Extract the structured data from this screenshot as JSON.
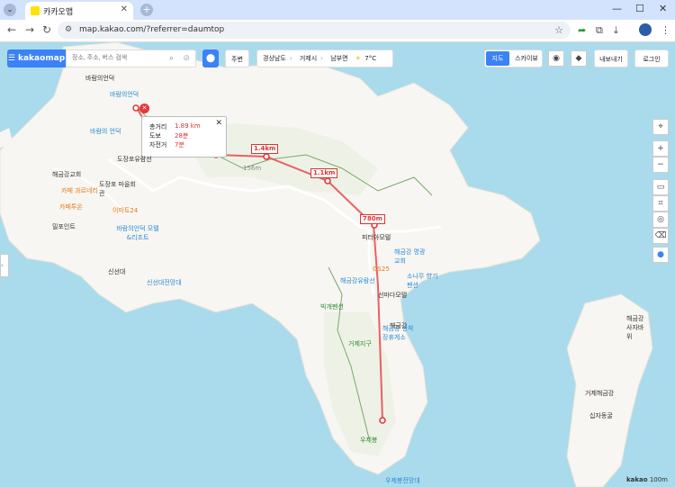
{
  "browser": {
    "tab_title": "카카오맵",
    "url": "map.kakao.com/?referrer=daumtop",
    "new_tab": "+",
    "tab_close": "✕"
  },
  "map_ui": {
    "logo": "kakaomap",
    "search_placeholder": "장소, 주소, 버스 검색",
    "nearby": "주변",
    "breadcrumb": [
      "경상남도",
      "거제시",
      "남부면"
    ],
    "weather": "7°C",
    "mode_map": "지도",
    "mode_sky": "스카이뷰",
    "export": "내보내기",
    "login": "로그인",
    "zoom_in": "+",
    "zoom_out": "−"
  },
  "route_popup": {
    "total_label": "총거리",
    "total_value": "1.89 km",
    "walk_label": "도보",
    "walk_value": "28분",
    "bike_label": "자전거",
    "bike_value": "7분"
  },
  "distance_markers": [
    "1.4km",
    "1.1km",
    "780m"
  ],
  "place_labels": {
    "p1": "바람의언덕",
    "p2": "바람의언덕",
    "p3": "바람의 언덕",
    "p4": "도장포유람선",
    "p5": "해금강교회",
    "p6": "도장포 마을회관",
    "p7": "카페 과르네리",
    "p8": "이마트24",
    "p9": "카페투온",
    "p10": "바람의언덕 모텔&리조트",
    "p11": "밀포인트",
    "p12": "신선대",
    "p13": "신선대전망대",
    "p14": "피터아모텔",
    "p15": "해금강 명광교회",
    "p16": "GS25",
    "p17": "소나무 향기펜션",
    "p18": "해금강유람선",
    "p19": "선마다모텔",
    "p20": "해금강 선착장휴게소",
    "p21": "해금강",
    "p22": "거제지구",
    "p23": "빅개펜션",
    "p24": "우제봉",
    "p25": "우제봉전망대",
    "p26": "해금강 사자바위",
    "p27": "거제해금강",
    "p28": "십자동굴",
    "p29": "156m",
    "scale_brand": "kakao",
    "scale_value": "100m"
  },
  "colors": {
    "route": "#e8474a",
    "land": "#f7f6f2",
    "sea": "#a9dbec",
    "accent": "#3b82f6"
  }
}
